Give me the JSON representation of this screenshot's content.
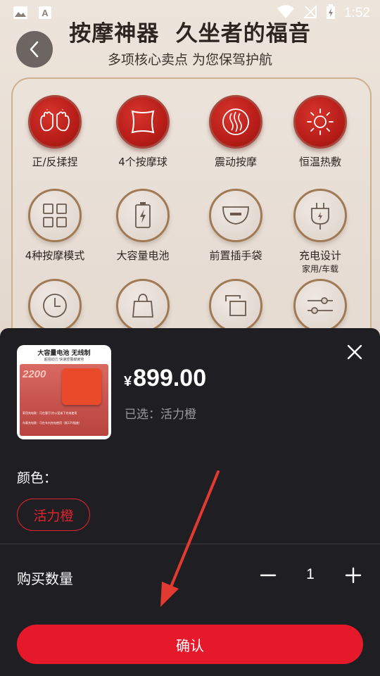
{
  "status_bar": {
    "time": "1:52"
  },
  "header": {
    "title": "按摩神器  久坐者的福音",
    "subtitle": "多项核心卖点 为您保驾护航"
  },
  "features": [
    {
      "label": "正/反揉捏",
      "icon": "kneading-hands-icon",
      "style": "red"
    },
    {
      "label": "4个按摩球",
      "icon": "pillow-icon",
      "style": "red"
    },
    {
      "label": "震动按摩",
      "icon": "vibration-icon",
      "style": "red"
    },
    {
      "label": "恒温热敷",
      "icon": "sun-heat-icon",
      "style": "red"
    },
    {
      "label": "4种按摩模式",
      "icon": "grid-modes-icon",
      "style": "light"
    },
    {
      "label": "大容量电池",
      "icon": "battery-icon",
      "style": "light"
    },
    {
      "label": "前置插手袋",
      "icon": "hand-pocket-icon",
      "style": "light"
    },
    {
      "label": "充电设计",
      "sub": "家用/车载",
      "icon": "charging-plug-icon",
      "style": "light"
    },
    {
      "label": "",
      "icon": "timer-icon",
      "style": "light"
    },
    {
      "label": "",
      "icon": "bag-icon",
      "style": "light"
    },
    {
      "label": "",
      "icon": "layers-icon",
      "style": "light"
    },
    {
      "label": "",
      "icon": "sliders-icon",
      "style": "light"
    }
  ],
  "sheet": {
    "thumbnail": {
      "headline": "大容量电池  无线制",
      "tagline": "超强动力 快速舒展缓疲劳",
      "big_number": "2200",
      "caption1": "家用充电款：可在客厅/办公室或下充电使用",
      "caption2": "车载充电款：可在车内充电使用（限12V插座）"
    },
    "price_symbol": "¥",
    "price": "899.00",
    "selected_text": "已选：活力橙",
    "color_label": "颜色：",
    "color_options": [
      "活力橙"
    ],
    "quantity_label": "购买数量",
    "quantity": "1",
    "confirm_label": "确认"
  },
  "colors": {
    "accent": "#e5192a",
    "sheet_bg": "#1f1e23"
  }
}
